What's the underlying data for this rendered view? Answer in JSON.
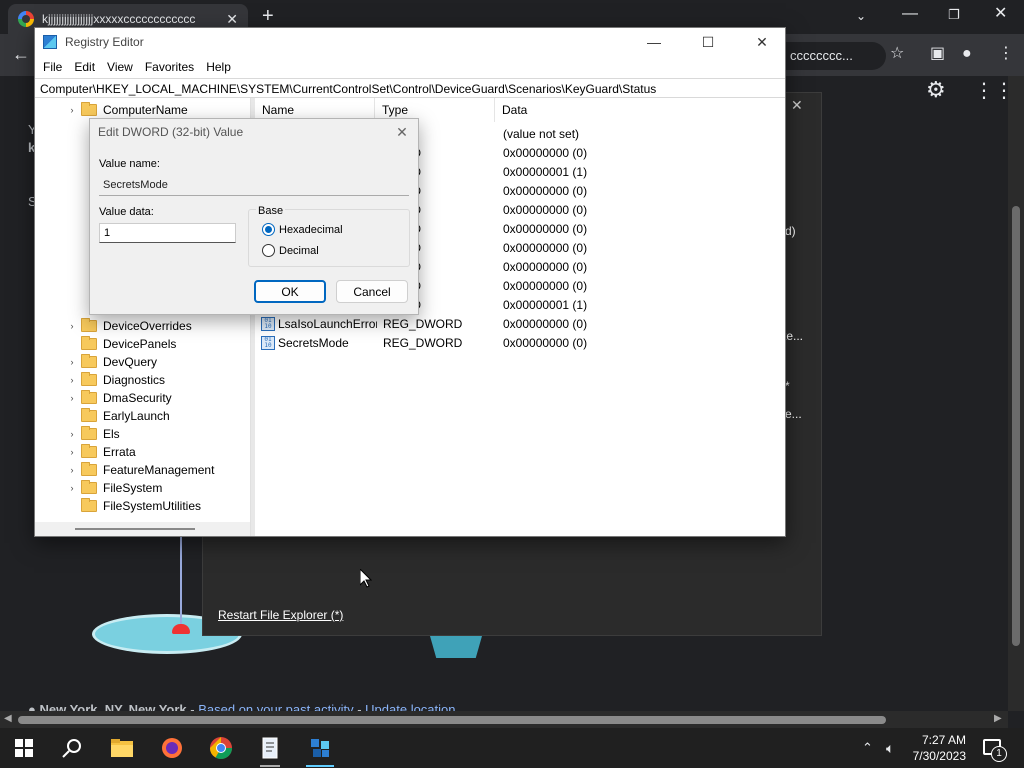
{
  "browser": {
    "tab_title": "kjjjjjjjjjjjjjjjjjxxxxxcccccccccccc",
    "omnibox_tail": "cccccccc...",
    "new_tab_symbol": "+"
  },
  "page": {
    "footer_location": "New York, NY, New York",
    "footer_activity": "Based on your past activity",
    "footer_update": "Update location",
    "frag_y": "Y",
    "frag_k": "k",
    "frag_s": "S",
    "panel_frag_d": "d)",
    "panel_frag_te": "te...",
    "panel_frag_star": "*",
    "panel_frag_e": "e..."
  },
  "dark_panel": {
    "link": "Restart File Explorer (*)"
  },
  "regedit": {
    "title": "Registry Editor",
    "menu": [
      "File",
      "Edit",
      "View",
      "Favorites",
      "Help"
    ],
    "address": "Computer\\HKEY_LOCAL_MACHINE\\SYSTEM\\CurrentControlSet\\Control\\DeviceGuard\\Scenarios\\KeyGuard\\Status",
    "tree": [
      "ComputerName",
      "DeviceOverrides",
      "DevicePanels",
      "DevQuery",
      "Diagnostics",
      "DmaSecurity",
      "EarlyLaunch",
      "Els",
      "Errata",
      "FeatureManagement",
      "FileSystem",
      "FileSystemUtilities"
    ],
    "columns": [
      "Name",
      "Type",
      "Data"
    ],
    "rows": [
      {
        "name": "",
        "type": "",
        "data": "(value not set)"
      },
      {
        "name": "",
        "type": "WORD",
        "data": "0x00000000 (0)"
      },
      {
        "name": "",
        "type": "WORD",
        "data": "0x00000001 (1)"
      },
      {
        "name": "",
        "type": "WORD",
        "data": "0x00000000 (0)"
      },
      {
        "name": "",
        "type": "WORD",
        "data": "0x00000000 (0)"
      },
      {
        "name": "",
        "type": "WORD",
        "data": "0x00000000 (0)"
      },
      {
        "name": "",
        "type": "WORD",
        "data": "0x00000000 (0)"
      },
      {
        "name": "",
        "type": "WORD",
        "data": "0x00000000 (0)"
      },
      {
        "name": "",
        "type": "WORD",
        "data": "0x00000000 (0)"
      },
      {
        "name": "",
        "type": "WORD",
        "data": "0x00000001 (1)"
      },
      {
        "name": "LsaIsoLaunchError",
        "type": "REG_DWORD",
        "data": "0x00000000 (0)"
      },
      {
        "name": "SecretsMode",
        "type": "REG_DWORD",
        "data": "0x00000000 (0)"
      }
    ]
  },
  "dialog": {
    "title": "Edit DWORD (32-bit) Value",
    "value_name_label": "Value name:",
    "value_name": "SecretsMode",
    "value_data_label": "Value data:",
    "value_data": "1",
    "base_label": "Base",
    "hex_label": "Hexadecimal",
    "dec_label": "Decimal",
    "selected_base": "Hexadecimal",
    "ok": "OK",
    "cancel": "Cancel"
  },
  "taskbar": {
    "time": "7:27 AM",
    "date": "7/30/2023",
    "notification_count": "1"
  },
  "icons": {
    "tab": "google-g-icon",
    "tab_close": "close-icon",
    "back": "arrow-left-icon",
    "share": "share-icon",
    "bookmark": "star-icon",
    "side_panel": "side-panel-icon",
    "profile": "profile-icon",
    "menu": "kebab-menu-icon",
    "settings": "gear-icon",
    "apps": "apps-grid-icon"
  }
}
